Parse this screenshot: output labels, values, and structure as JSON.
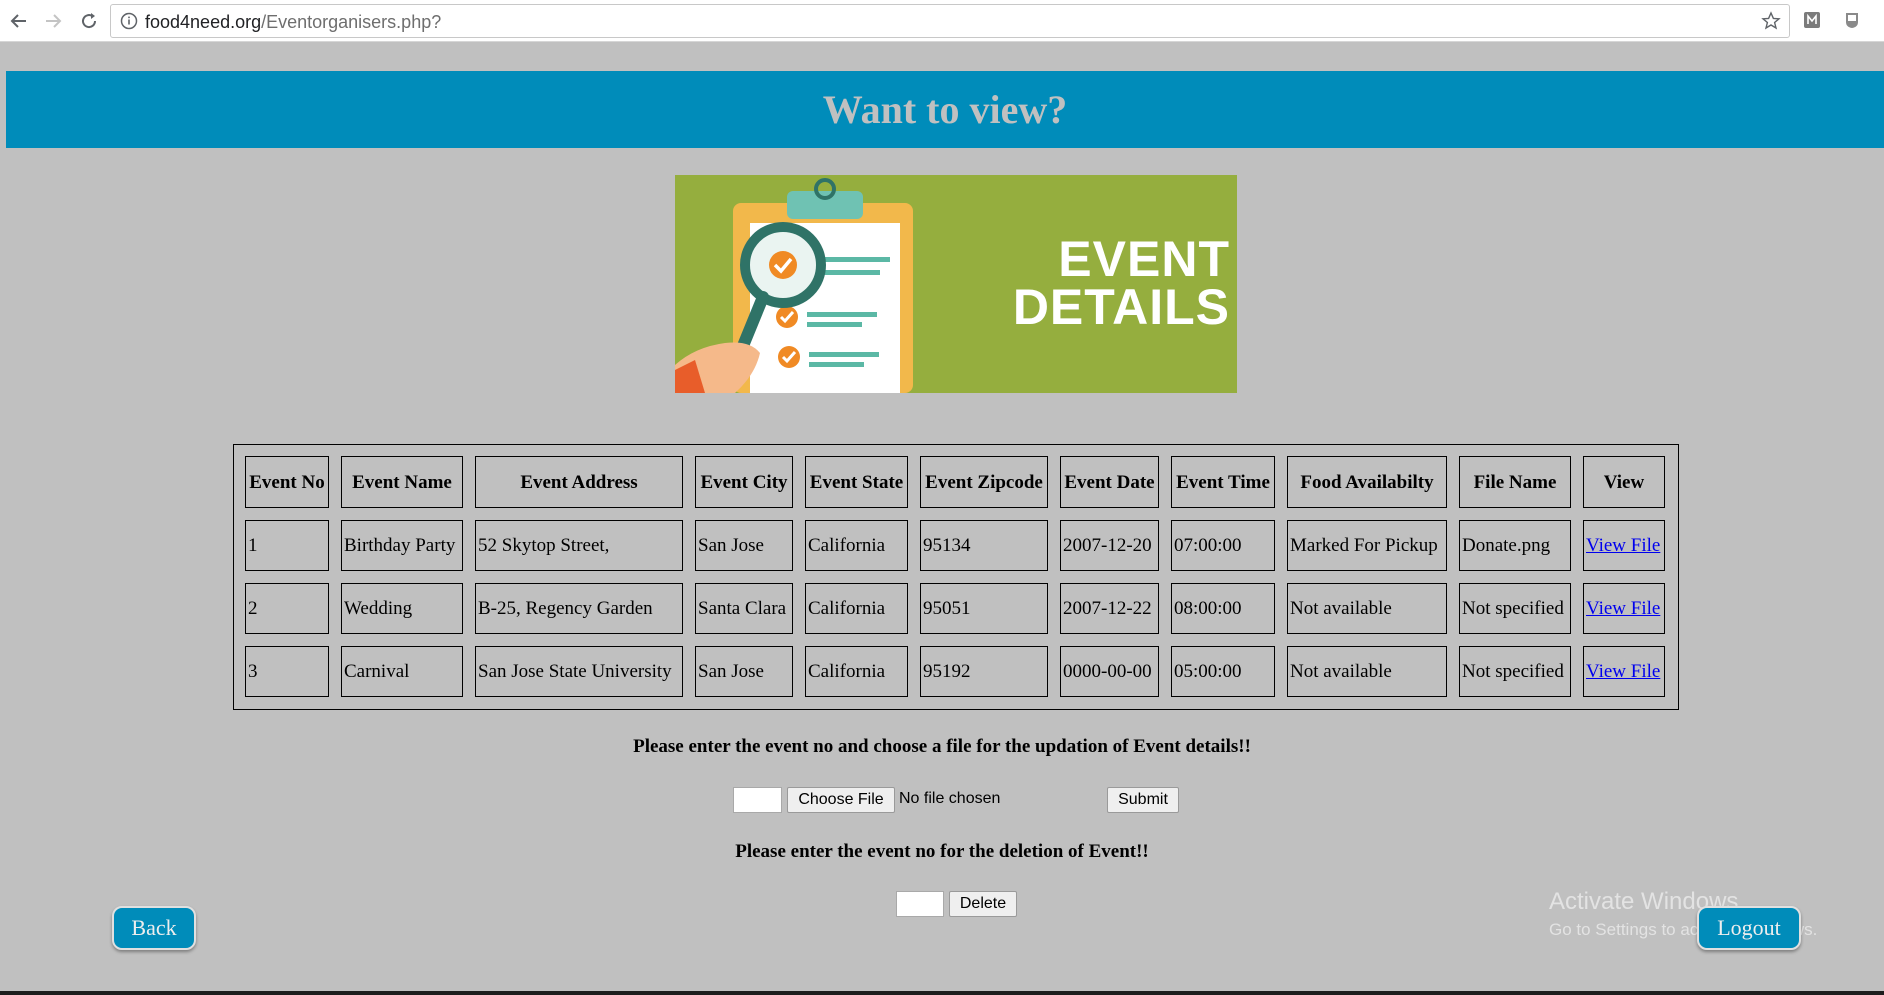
{
  "browser": {
    "url_host": "food4need.org",
    "url_path": "/Eventorganisers.php?"
  },
  "banner": {
    "title": "Want to view?"
  },
  "hero": {
    "line1": "EVENT",
    "line2": "DETAILS"
  },
  "table": {
    "headers": [
      "Event No",
      "Event Name",
      "Event Address",
      "Event City",
      "Event State",
      "Event Zipcode",
      "Event Date",
      "Event Time",
      "Food Availabilty",
      "File Name",
      "View"
    ],
    "rows": [
      [
        "1",
        "Birthday Party",
        "52 Skytop Street,",
        "San Jose",
        "California",
        "95134",
        "2007-12-20",
        "07:00:00",
        "Marked For Pickup",
        "Donate.png",
        "View File"
      ],
      [
        "2",
        "Wedding",
        "B-25, Regency Garden",
        "Santa Clara",
        "California",
        "95051",
        "2007-12-22",
        "08:00:00",
        "Not available",
        "Not specified",
        "View File"
      ],
      [
        "3",
        "Carnival",
        "San Jose State University",
        "San Jose",
        "California",
        "95192",
        "0000-00-00",
        "05:00:00",
        "Not available",
        "Not specified",
        "View File"
      ]
    ]
  },
  "update_form": {
    "prompt": "Please enter the event no and choose a file for the updation of Event details!!",
    "event_no_value": "",
    "choose_file_label": "Choose File",
    "file_status": "No file chosen",
    "submit_label": "Submit"
  },
  "delete_form": {
    "prompt": "Please enter the event no for the deletion of Event!!",
    "event_no_value": "",
    "delete_label": "Delete"
  },
  "buttons": {
    "back": "Back",
    "logout": "Logout"
  },
  "watermark": {
    "line1": "Activate Windows",
    "line2": "Go to Settings to activate Windows."
  },
  "colors": {
    "banner": "#008cba",
    "page_bg": "#c0c0c0",
    "hero_bg": "#95ae3e",
    "link": "#0000ee"
  }
}
